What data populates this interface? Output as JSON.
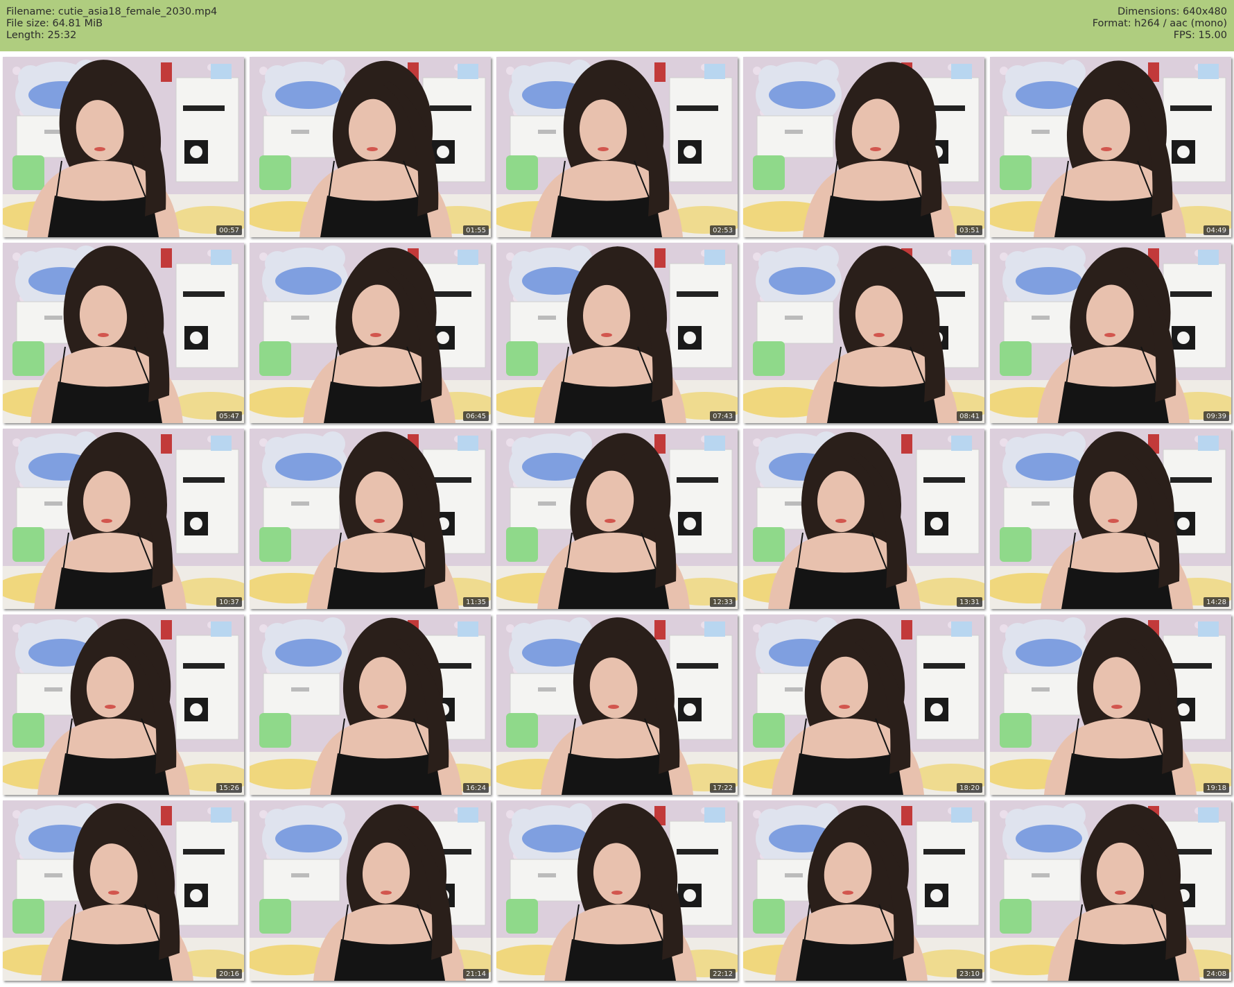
{
  "header": {
    "filename": "Filename: cutie_asia18_female_2030.mp4",
    "filesize": "File size: 64.81 MiB",
    "length": "Length: 25:32",
    "dimensions": "Dimensions: 640x480",
    "format": "Format: h264 / aac (mono)",
    "fps": "FPS: 15.00"
  },
  "thumbnails": [
    "00:57",
    "01:55",
    "02:53",
    "03:51",
    "04:49",
    "05:47",
    "06:45",
    "07:43",
    "08:41",
    "09:39",
    "10:37",
    "11:35",
    "12:33",
    "13:31",
    "14:28",
    "15:26",
    "16:24",
    "17:22",
    "18:20",
    "19:18",
    "20:16",
    "21:14",
    "22:12",
    "23:10",
    "24:08"
  ],
  "colors": {
    "header_bg": "#afcd7f",
    "wallpaper": "#dccfdc",
    "furniture": "#f4f4f2",
    "teddy": "#dfe3ee",
    "teddy_shirt": "#7f9fe0",
    "hair": "#2a1f1a",
    "skin": "#e8c1ae",
    "top": "#141414",
    "floor": "#f0d46a",
    "green_tub": "#8fd98a"
  }
}
